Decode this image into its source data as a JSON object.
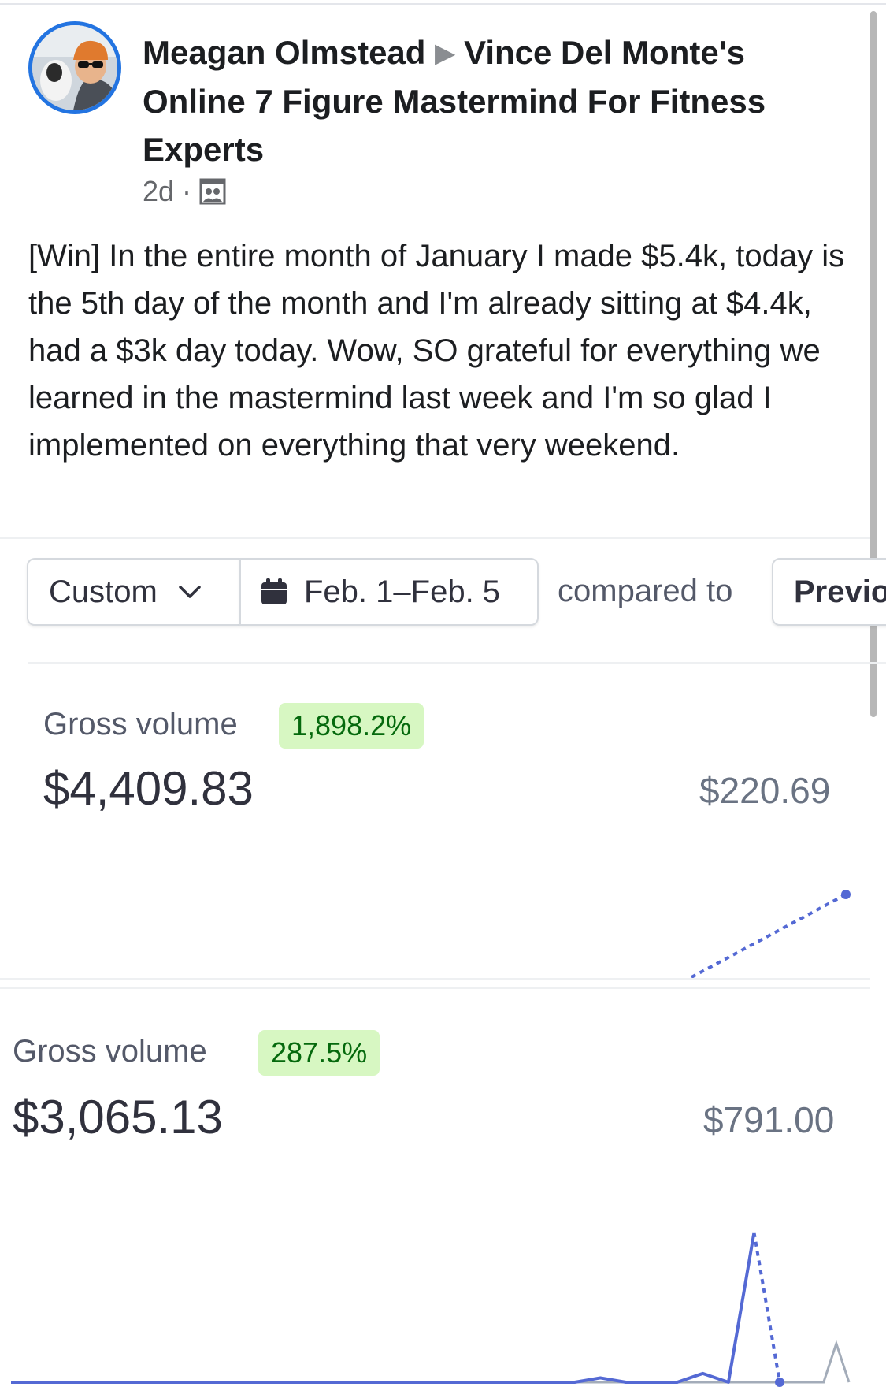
{
  "post": {
    "author": "Meagan Olmstead",
    "group": "Vince Del Monte's Online 7 Figure Mastermind For Fitness Experts",
    "time": "2d",
    "separator": "·",
    "audience_icon": "group-audience-icon",
    "body": "[Win] In the entire month of January I made $5.4k, today is the 5th day of the month and I'm already sitting at $4.4k, had a $3k day today. Wow, SO grateful for everything we learned in the mastermind last week and I'm so glad I implemented on everything that very weekend."
  },
  "dashboard": {
    "filters": {
      "range_type": "Custom",
      "date_range": "Feb. 1–Feb. 5",
      "compared_to_label": "compared to",
      "comparison": "Previous period"
    },
    "metrics": [
      {
        "label": "Gross volume",
        "change": "1,898.2%",
        "value": "$4,409.83",
        "previous_value": "$220.69"
      },
      {
        "label": "Gross volume",
        "change": "287.5%",
        "value": "$3,065.13",
        "previous_value": "$791.00"
      }
    ]
  },
  "colors": {
    "accent_blue": "#2374e1",
    "series_current": "#5469d4",
    "series_previous": "#a3acb9",
    "badge_bg": "#d7f7c2",
    "badge_text": "#05690d"
  },
  "chart_data": [
    {
      "type": "line",
      "series": [
        {
          "values": [
            0,
            220.69
          ]
        }
      ]
    },
    {
      "type": "line",
      "series": [
        {
          "values": [
            0,
            0,
            0,
            0,
            0,
            0,
            0,
            0,
            0,
            0,
            0,
            0,
            0,
            0,
            0,
            0,
            0,
            0,
            0,
            0,
            0,
            0,
            0,
            90,
            0,
            0,
            0,
            180,
            0,
            3065.13,
            0
          ]
        },
        {
          "values": [
            0,
            0,
            0,
            0,
            0,
            0,
            0,
            0,
            0,
            0,
            0,
            0,
            0,
            0,
            0,
            0,
            0,
            0,
            0,
            0,
            0,
            0,
            0,
            0,
            0,
            0,
            0,
            0,
            0,
            0,
            0,
            0,
            0,
            0,
            0,
            0,
            0,
            0,
            0,
            0,
            0,
            0,
            0,
            0,
            0,
            0,
            0,
            0,
            0,
            0,
            0,
            0,
            0,
            0,
            0,
            0,
            0,
            0,
            0,
            0,
            0,
            0,
            0,
            0,
            0,
            791.0,
            0
          ]
        }
      ]
    }
  ]
}
